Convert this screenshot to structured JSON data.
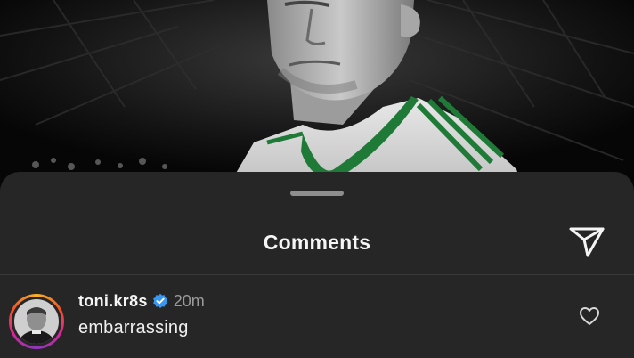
{
  "post": {
    "image": "footballer-portrait-photo"
  },
  "comments_sheet": {
    "title": "Comments",
    "send_icon": "paper-plane-icon",
    "comments": [
      {
        "username": "toni.kr8s",
        "verified": true,
        "timestamp": "20m",
        "text": "embarrassing",
        "like_icon": "heart-outline-icon"
      }
    ]
  },
  "colors": {
    "sheet_background": "#262626",
    "verified_badge": "#3897f0",
    "text_primary": "#f5f5f5",
    "text_secondary": "#9a9a9a"
  }
}
